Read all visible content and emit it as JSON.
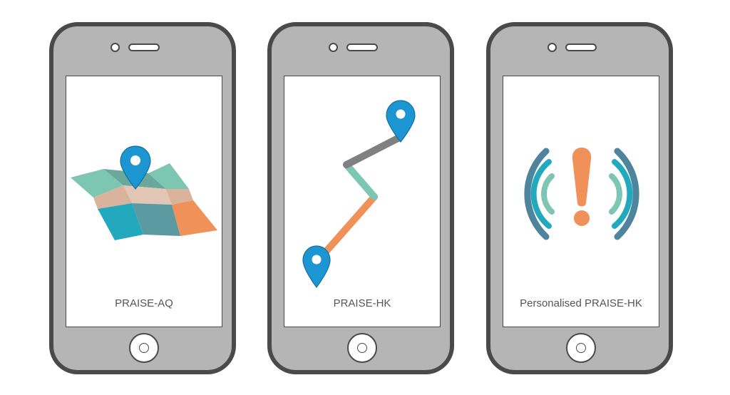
{
  "phones": [
    {
      "label": "PRAISE-AQ",
      "icon": "folded-map-with-pin"
    },
    {
      "label": "PRAISE-HK",
      "icon": "route-with-pins"
    },
    {
      "label": "Personalised PRAISE-HK",
      "icon": "alert-with-signal-waves"
    }
  ],
  "colors": {
    "phone_body": "#b5b5b5",
    "phone_border": "#4a4a4a",
    "pin": "#1c96d3",
    "teal": "#7cc6b2",
    "dark_teal": "#22a9be",
    "orange": "#ef9159",
    "grey_route": "#808080",
    "wave_blue": "#4e849c"
  }
}
